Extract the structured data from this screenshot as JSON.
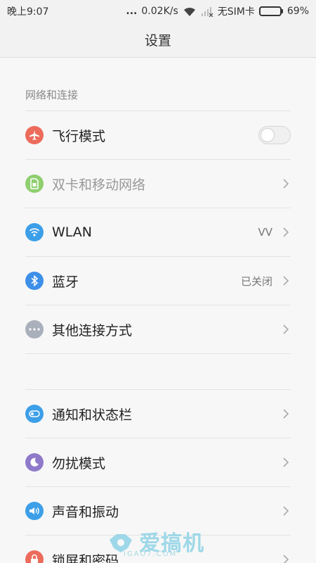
{
  "status_bar": {
    "time": "晚上9:07",
    "dots": "...",
    "speed": "0.02K/s",
    "sim": "无SIM卡",
    "battery_level": 69,
    "battery_text": "69%"
  },
  "title": "设置",
  "section_network": {
    "header": "网络和连接",
    "items": [
      {
        "label": "飞行模式",
        "icon": "airplane-icon",
        "color": "#ec6b5b"
      },
      {
        "label": "双卡和移动网络",
        "icon": "sim-card-icon",
        "color": "#8fcf6f"
      },
      {
        "label": "WLAN",
        "value": "VV",
        "icon": "wifi-icon",
        "color": "#3d9fe8"
      },
      {
        "label": "蓝牙",
        "value": "已关闭",
        "icon": "bluetooth-icon",
        "color": "#3d8fe8"
      },
      {
        "label": "其他连接方式",
        "icon": "more-dots-icon",
        "color": "#a9b0bb"
      }
    ]
  },
  "section_personal": {
    "items": [
      {
        "label": "通知和状态栏",
        "icon": "toggle-icon",
        "color": "#3d9fe8"
      },
      {
        "label": "勿扰模式",
        "icon": "moon-icon",
        "color": "#8f79c9"
      },
      {
        "label": "声音和振动",
        "icon": "speaker-icon",
        "color": "#3d9fe8"
      },
      {
        "label": "锁屏和密码",
        "icon": "lock-icon",
        "color": "#ec6b5b"
      }
    ]
  },
  "watermark": {
    "text": "爱搞机",
    "sub": "IGAO7.COM"
  }
}
